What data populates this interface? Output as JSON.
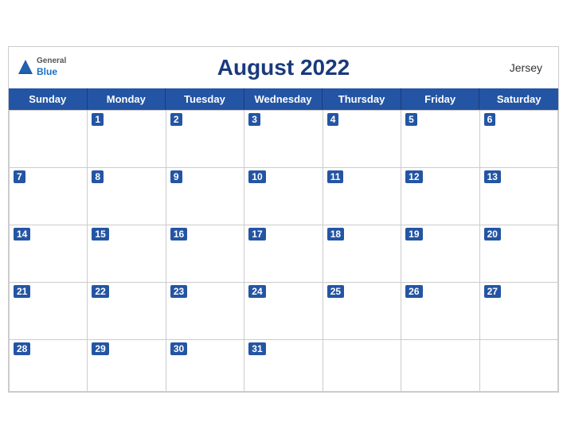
{
  "header": {
    "title": "August 2022",
    "region": "Jersey",
    "logo_general": "General",
    "logo_blue": "Blue"
  },
  "days_of_week": [
    "Sunday",
    "Monday",
    "Tuesday",
    "Wednesday",
    "Thursday",
    "Friday",
    "Saturday"
  ],
  "weeks": [
    [
      null,
      1,
      2,
      3,
      4,
      5,
      6
    ],
    [
      7,
      8,
      9,
      10,
      11,
      12,
      13
    ],
    [
      14,
      15,
      16,
      17,
      18,
      19,
      20
    ],
    [
      21,
      22,
      23,
      24,
      25,
      26,
      27
    ],
    [
      28,
      29,
      30,
      31,
      null,
      null,
      null
    ]
  ],
  "colors": {
    "header_blue": "#2455a4",
    "dark_blue": "#1a3a7c",
    "text_white": "#ffffff"
  }
}
